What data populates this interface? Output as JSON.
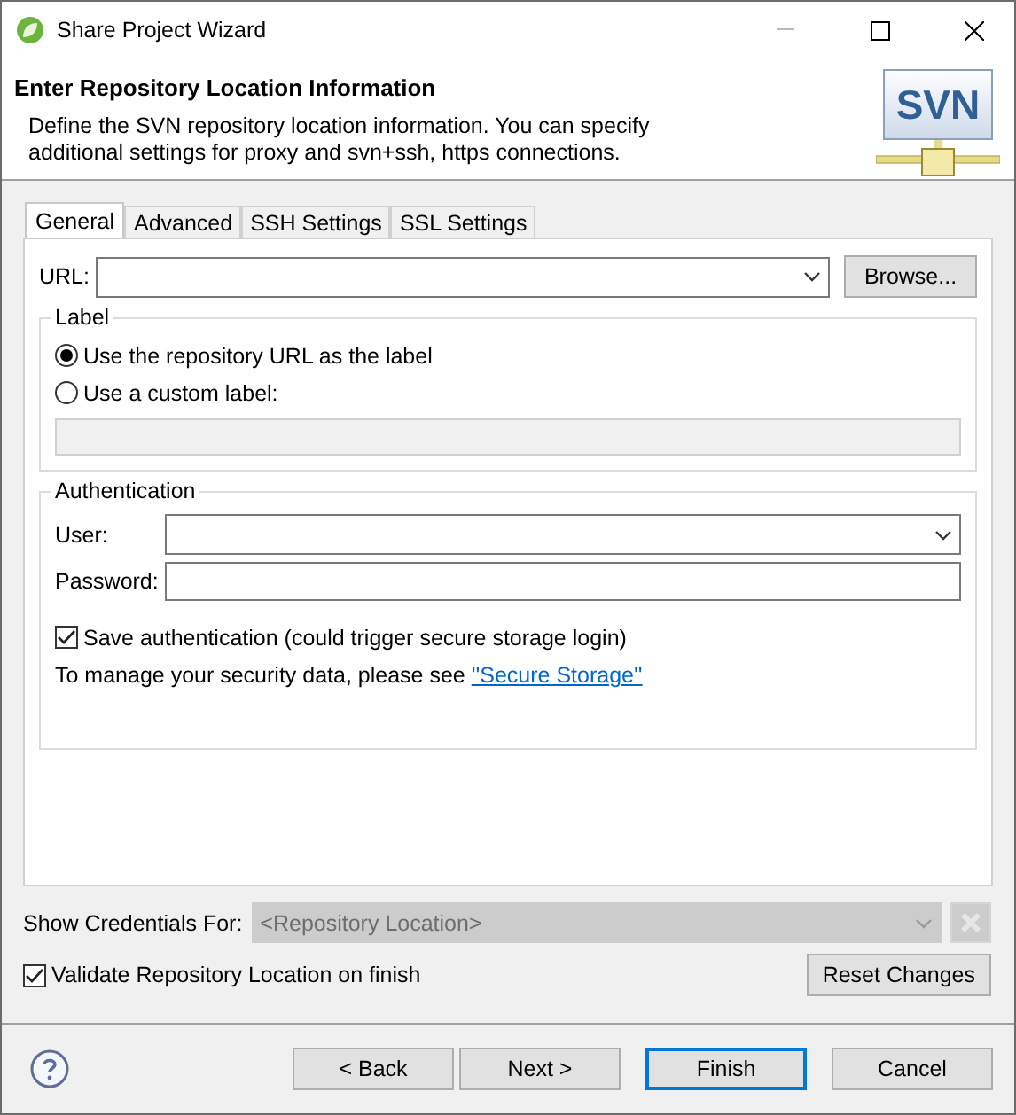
{
  "window": {
    "title": "Share Project Wizard"
  },
  "header": {
    "title": "Enter Repository Location Information",
    "description_lines": [
      "Define the SVN repository location information. You can specify",
      "additional settings for proxy and svn+ssh, https connections."
    ],
    "logo": "SVN"
  },
  "tabs": [
    {
      "label": "General",
      "selected": true
    },
    {
      "label": "Advanced",
      "selected": false
    },
    {
      "label": "SSH Settings",
      "selected": false
    },
    {
      "label": "SSL Settings",
      "selected": false
    }
  ],
  "url": {
    "label": "URL:",
    "button": "Browse..."
  },
  "label_group": {
    "title": "Label",
    "options": [
      {
        "label": "Use the repository URL as the label",
        "selected": true
      },
      {
        "label": "Use a custom label:",
        "selected": false
      }
    ],
    "custom_field_disabled": true
  },
  "auth_group": {
    "title": "Authentication",
    "user_label": "User:",
    "password_label": "Password:",
    "save": {
      "label": "Save authentication (could trigger secure storage login)",
      "checked": true
    },
    "note": "To manage your security data, please see ",
    "link": "''Secure Storage''"
  },
  "credentials": {
    "label": "Show Credentials For:",
    "placeholder": "<Repository Location>",
    "disabled": true
  },
  "validate": {
    "label": "Validate Repository Location on finish",
    "checked": true
  },
  "reset_button": "Reset Changes",
  "buttons": [
    {
      "label": "< Back",
      "default": false
    },
    {
      "label": "Next >",
      "default": false
    },
    {
      "label": "Finish",
      "default": true
    },
    {
      "label": "Cancel",
      "default": false
    }
  ]
}
